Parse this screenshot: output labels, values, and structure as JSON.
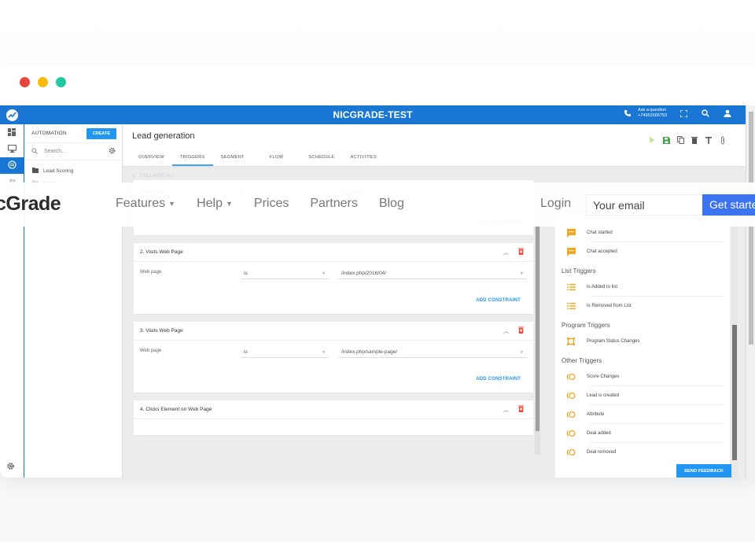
{
  "window": {
    "traffic_lights": [
      {
        "name": "close",
        "color": "#e8453c"
      },
      {
        "name": "minimize",
        "color": "#f7bb0e"
      },
      {
        "name": "maximize",
        "color": "#1ec8a0"
      }
    ]
  },
  "colors": {
    "primary": "#1976d2",
    "accent": "#2196f3",
    "danger": "#f44336",
    "trigger_icon": "#f7a41d",
    "save_green": "#43a047",
    "cta": "#3b73f0"
  },
  "topbar": {
    "title": "NICGRADE-TEST",
    "ask_label": "Ask a question",
    "phone": "+74952666753",
    "icons": [
      "phone-icon",
      "fullscreen-icon",
      "search-icon",
      "user-icon"
    ]
  },
  "rail": {
    "items": [
      {
        "icon": "dashboard-icon",
        "active": false
      },
      {
        "icon": "monitor-icon",
        "active": false
      },
      {
        "icon": "automation-icon",
        "active": true
      },
      {
        "icon": "users-icon",
        "active": false
      }
    ],
    "bottom_icon": "settings-icon"
  },
  "panel": {
    "title": "AUTOMATION",
    "create_label": "CREATE",
    "search_placeholder": "Search...",
    "items": [
      {
        "label": "Lead Scoring",
        "faded": false
      },
      {
        "label": "Users",
        "faded": true
      },
      {
        "label": "",
        "faded": true
      }
    ]
  },
  "main": {
    "title": "Lead generation",
    "tabs": [
      {
        "label": "OVERVIEW",
        "active": false
      },
      {
        "label": "TRIGGERS",
        "active": true
      },
      {
        "label": "SEGMENT",
        "active": false
      },
      {
        "label": "FLOW",
        "active": false
      },
      {
        "label": "SCHEDULE",
        "active": false
      },
      {
        "label": "ACTIVITIES",
        "active": false
      }
    ],
    "toolbar": [
      "play-icon",
      "save-icon",
      "copy-icon",
      "delete-icon",
      "text-icon",
      "attach-icon"
    ],
    "collapse_all": "COLLAPSE ALL",
    "add_constraint": "ADD CONSTRAINT",
    "cards": [
      {
        "title": "",
        "field": "Form Name",
        "operator": "is",
        "value": "Web form",
        "partial_top": true
      },
      {
        "title": "2. Visits Web Page",
        "field": "Web page",
        "operator": "is",
        "value": "/index.php/2016/04/"
      },
      {
        "title": "3. Visits Web Page",
        "field": "Web page",
        "operator": "is",
        "value": "/index.php/sample-page/"
      },
      {
        "title": "4. Clicks Element on Web Page",
        "field": "",
        "operator": "",
        "value": "",
        "collapsed_body": true
      }
    ]
  },
  "triggers_panel": {
    "groups": [
      {
        "title": "",
        "items": [
          {
            "label": "Chat started",
            "icon": "chat-icon"
          },
          {
            "label": "Chat accepted",
            "icon": "chat-icon"
          }
        ]
      },
      {
        "title": "List Triggers",
        "items": [
          {
            "label": "Is Added to list",
            "icon": "list-icon"
          },
          {
            "label": "Is Removed from List",
            "icon": "list-icon"
          }
        ]
      },
      {
        "title": "Program Triggers",
        "items": [
          {
            "label": "Program Status Changes",
            "icon": "program-icon"
          }
        ]
      },
      {
        "title": "Other Triggers",
        "items": [
          {
            "label": "Score Changes",
            "icon": "signal-icon"
          },
          {
            "label": "Lead is created",
            "icon": "signal-icon"
          },
          {
            "label": "Attribute",
            "icon": "signal-icon"
          },
          {
            "label": "Deal added",
            "icon": "signal-icon"
          },
          {
            "label": "Deal removed",
            "icon": "signal-icon"
          }
        ]
      }
    ],
    "feedback_label": "SEND FEEDBACK"
  },
  "overlay_nav": {
    "brand": "cGrade",
    "links": [
      {
        "label": "Features",
        "dropdown": true
      },
      {
        "label": "Help",
        "dropdown": true
      },
      {
        "label": "Prices",
        "dropdown": false
      },
      {
        "label": "Partners",
        "dropdown": false
      },
      {
        "label": "Blog",
        "dropdown": false
      }
    ],
    "login": "Login",
    "email_placeholder": "Your email",
    "cta": "Get started"
  }
}
